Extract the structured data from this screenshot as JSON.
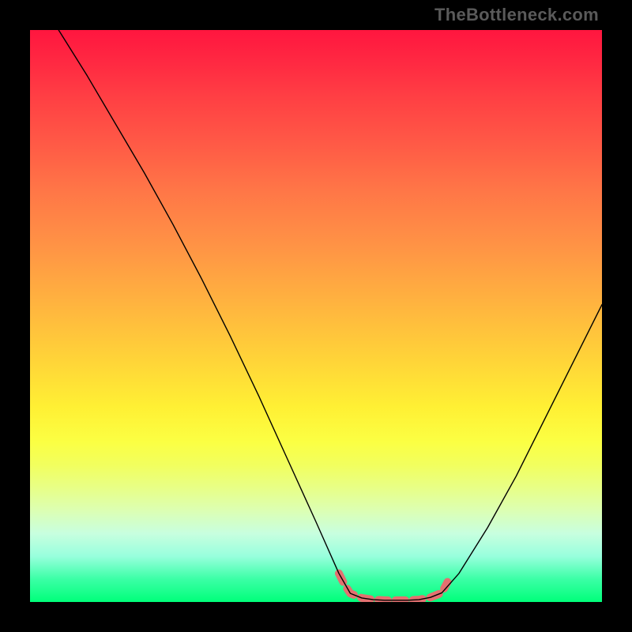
{
  "watermark": "TheBottleneck.com",
  "chart_data": {
    "type": "line",
    "title": "",
    "xlabel": "",
    "ylabel": "",
    "xlim": [
      0,
      100
    ],
    "ylim": [
      0,
      100
    ],
    "grid": false,
    "legend": false,
    "series": [
      {
        "name": "left-branch",
        "x": [
          5.0,
          10.0,
          15.0,
          20.0,
          25.0,
          30.0,
          35.0,
          40.0,
          45.0,
          50.0,
          54.0,
          56.0
        ],
        "values": [
          100.0,
          92.0,
          83.5,
          75.0,
          66.0,
          56.5,
          46.5,
          36.0,
          25.0,
          14.0,
          5.0,
          1.5
        ]
      },
      {
        "name": "floor",
        "x": [
          56.0,
          58.0,
          60.0,
          62.0,
          64.0,
          66.0,
          68.0,
          70.0,
          72.0
        ],
        "values": [
          1.5,
          0.7,
          0.4,
          0.3,
          0.3,
          0.3,
          0.4,
          0.8,
          1.6
        ]
      },
      {
        "name": "right-branch",
        "x": [
          72.0,
          75.0,
          80.0,
          85.0,
          90.0,
          95.0,
          100.0
        ],
        "values": [
          1.6,
          5.0,
          13.0,
          22.0,
          32.0,
          42.0,
          52.0
        ]
      }
    ],
    "highlight": {
      "name": "salmon-segment",
      "x": [
        54.0,
        55.0,
        56.0,
        58.0,
        60.0,
        62.0,
        64.0,
        66.0,
        68.0,
        70.0,
        72.0,
        73.0
      ],
      "values": [
        5.0,
        3.0,
        1.5,
        0.7,
        0.4,
        0.3,
        0.3,
        0.3,
        0.4,
        0.8,
        1.6,
        3.5
      ]
    },
    "gradient_stops": [
      {
        "pos": 0,
        "color": "#ff163f"
      },
      {
        "pos": 12,
        "color": "#ff4044"
      },
      {
        "pos": 28,
        "color": "#ff7647"
      },
      {
        "pos": 48,
        "color": "#ffb43f"
      },
      {
        "pos": 66,
        "color": "#fff034"
      },
      {
        "pos": 80,
        "color": "#e8ff86"
      },
      {
        "pos": 92,
        "color": "#98ffdd"
      },
      {
        "pos": 100,
        "color": "#00ff7a"
      }
    ],
    "curve_color": "#000000",
    "highlight_color": "#e37070"
  }
}
